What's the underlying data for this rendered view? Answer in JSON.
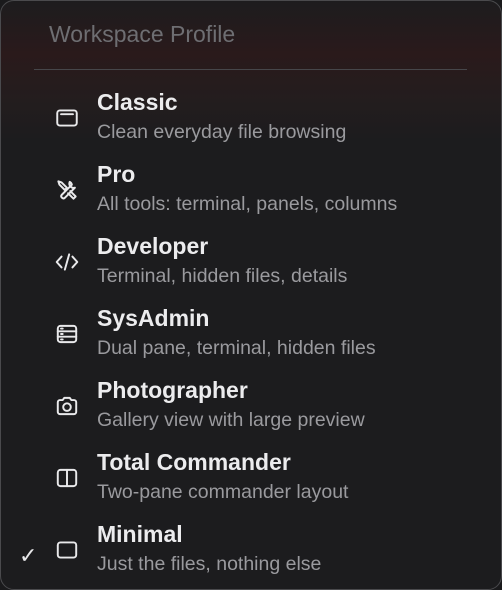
{
  "menu": {
    "header": "Workspace Profile",
    "items": [
      {
        "icon": "window-icon",
        "title": "Classic",
        "desc": "Clean everyday file browsing",
        "checked": false
      },
      {
        "icon": "tools-icon",
        "title": "Pro",
        "desc": "All tools: terminal, panels, columns",
        "checked": false
      },
      {
        "icon": "code-icon",
        "title": "Developer",
        "desc": "Terminal, hidden files, details",
        "checked": false
      },
      {
        "icon": "server-icon",
        "title": "SysAdmin",
        "desc": "Dual pane, terminal, hidden files",
        "checked": false
      },
      {
        "icon": "camera-icon",
        "title": "Photographer",
        "desc": "Gallery view with large preview",
        "checked": false
      },
      {
        "icon": "split-pane-icon",
        "title": "Total Commander",
        "desc": "Two-pane commander layout",
        "checked": false
      },
      {
        "icon": "square-icon",
        "title": "Minimal",
        "desc": "Just the files, nothing else",
        "checked": true
      }
    ],
    "check_glyph": "✓"
  }
}
